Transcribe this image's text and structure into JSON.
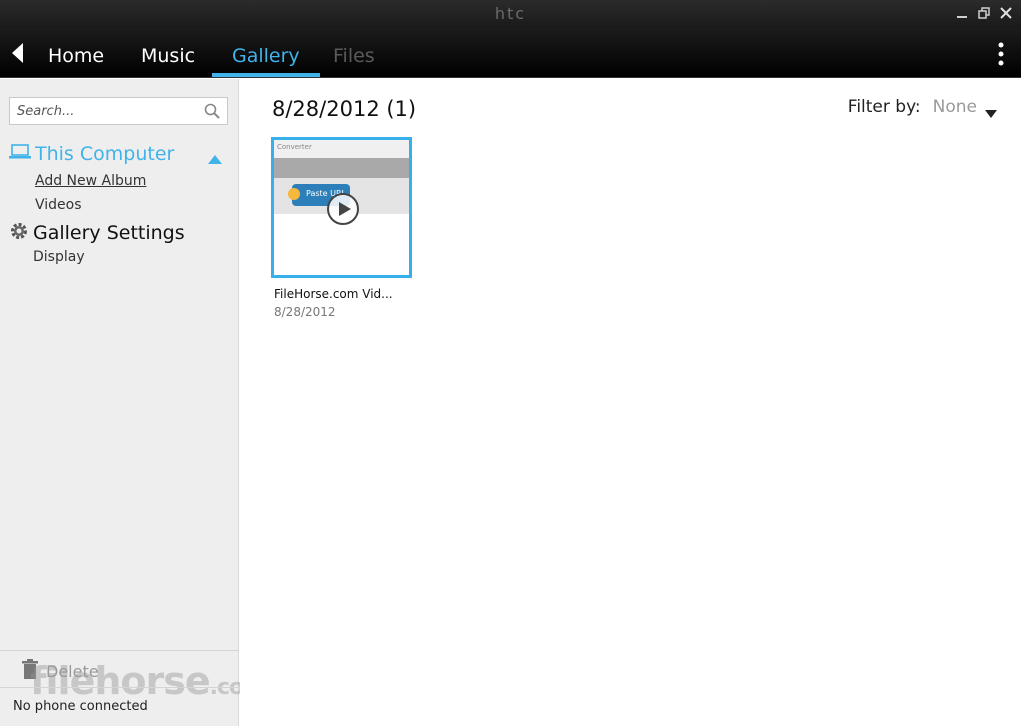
{
  "window": {
    "brand": "htc",
    "controls": [
      "minimize-icon",
      "restore-icon",
      "close-icon"
    ]
  },
  "nav": {
    "tabs": [
      {
        "label": "Home",
        "state": "normal"
      },
      {
        "label": "Music",
        "state": "normal"
      },
      {
        "label": "Gallery",
        "state": "active"
      },
      {
        "label": "Files",
        "state": "disabled"
      }
    ],
    "accent": "#3fb3ea"
  },
  "sidebar": {
    "search": {
      "placeholder": "Search..."
    },
    "this_computer": {
      "label": "This Computer",
      "items": [
        "Add New Album",
        "Videos"
      ]
    },
    "gallery_settings": {
      "label": "Gallery Settings",
      "items": [
        "Display"
      ]
    },
    "footer": {
      "delete_label": "Delete",
      "status": "No phone connected"
    },
    "watermark": {
      "main": "filehorse",
      "suffix": ".com"
    }
  },
  "main": {
    "heading": "8/28/2012 (1)",
    "filter": {
      "label": "Filter by:",
      "value": "None"
    },
    "items": [
      {
        "title": "FileHorse.com Vid...",
        "date": "8/28/2012",
        "thumb_header": "Converter",
        "thumb_button": "Paste URL"
      }
    ]
  }
}
